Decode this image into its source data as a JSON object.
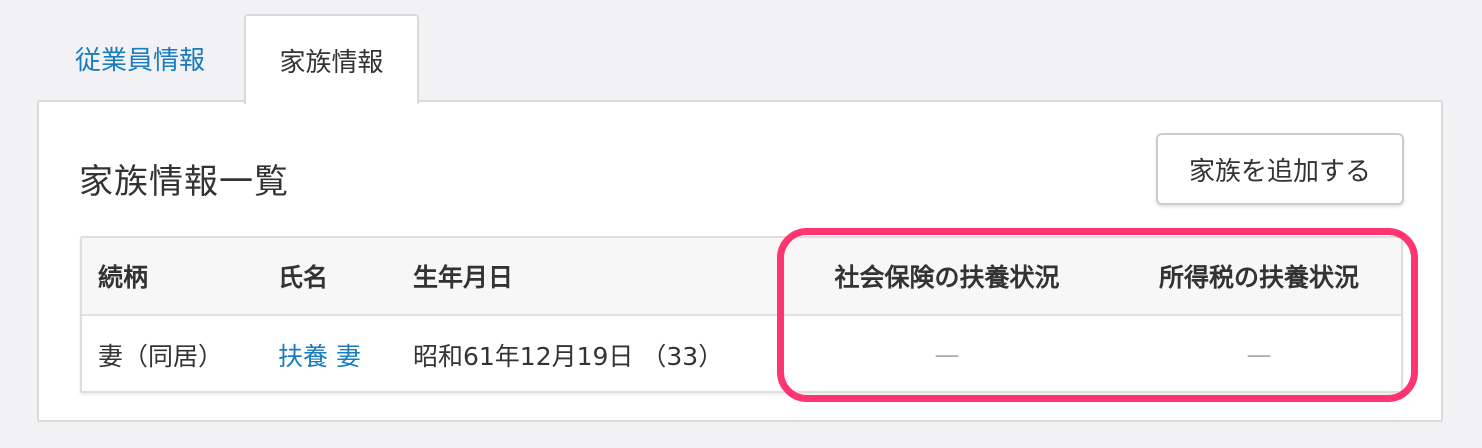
{
  "tabs": {
    "employee": "従業員情報",
    "family": "家族情報"
  },
  "panel": {
    "title": "家族情報一覧",
    "add_button": "家族を追加する"
  },
  "table": {
    "headers": [
      "続柄",
      "氏名",
      "生年月日",
      "社会保険の扶養状況",
      "所得税の扶養状況"
    ],
    "rows": [
      {
        "relation": "妻（同居）",
        "name": "扶養 妻",
        "birthdate": "昭和61年12月19日 （33）",
        "social_insurance": "—",
        "income_tax": "—"
      }
    ]
  },
  "accent_colors": {
    "link": "#1a7cbf",
    "highlight": "#ff3572"
  }
}
